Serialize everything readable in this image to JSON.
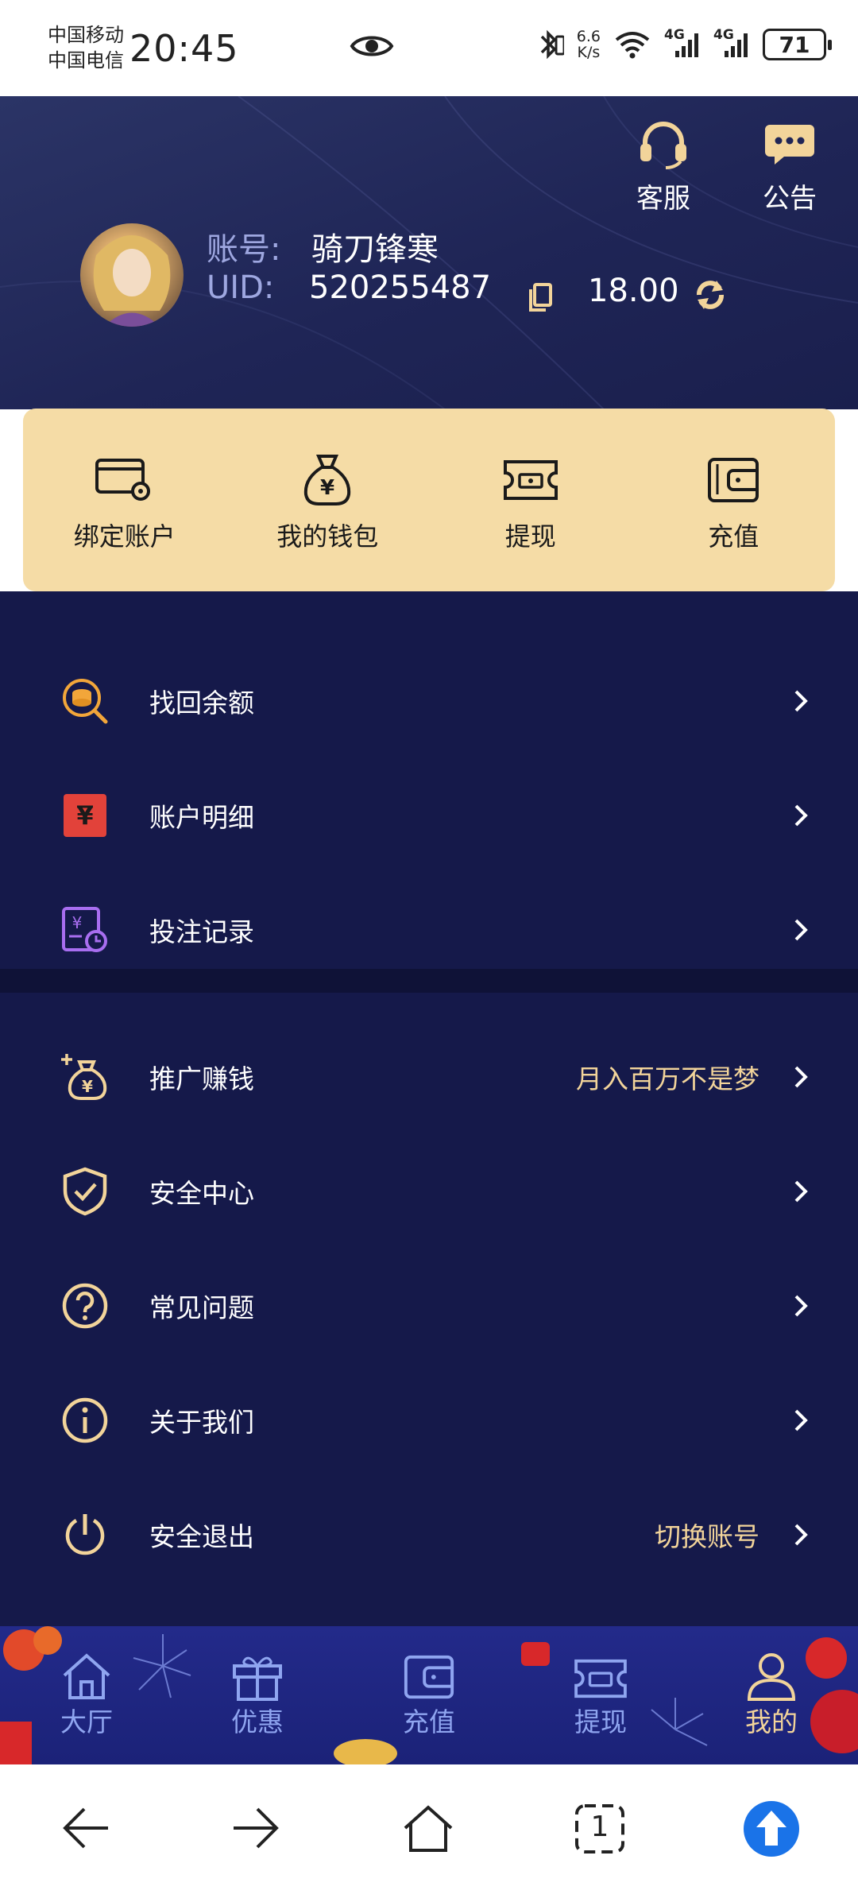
{
  "status_bar": {
    "carrier1": "中国移动",
    "carrier2": "中国电信",
    "time": "20:45",
    "net_speed_value": "6.6",
    "net_speed_unit": "K/s",
    "network1": "4G",
    "network2": "4G",
    "battery": "71"
  },
  "header": {
    "service_label": "客服",
    "notice_label": "公告",
    "account_label": "账号:",
    "account_value": "骑刀锋寒",
    "uid_label": "UID:",
    "uid_value": "520255487",
    "balance": "18.00"
  },
  "quick_actions": [
    {
      "label": "绑定账户",
      "icon": "card-settings-icon"
    },
    {
      "label": "我的钱包",
      "icon": "money-bag-icon"
    },
    {
      "label": "提现",
      "icon": "ticket-icon"
    },
    {
      "label": "充值",
      "icon": "wallet-icon"
    }
  ],
  "menu": [
    {
      "label": "找回余额",
      "icon": "coin-search-icon",
      "sub": ""
    },
    {
      "label": "账户明细",
      "icon": "account-detail-icon",
      "sub": ""
    },
    {
      "label": "投注记录",
      "icon": "bet-record-icon",
      "sub": ""
    },
    {
      "label": "推广赚钱",
      "icon": "promo-bag-icon",
      "sub": "月入百万不是梦"
    },
    {
      "label": "安全中心",
      "icon": "shield-check-icon",
      "sub": ""
    },
    {
      "label": "常见问题",
      "icon": "question-icon",
      "sub": ""
    },
    {
      "label": "关于我们",
      "icon": "info-icon",
      "sub": ""
    },
    {
      "label": "安全退出",
      "icon": "power-icon",
      "sub": "切换账号"
    }
  ],
  "tabbar": [
    {
      "label": "大厅",
      "icon": "home-icon"
    },
    {
      "label": "优惠",
      "icon": "gift-icon"
    },
    {
      "label": "充值",
      "icon": "wallet-icon"
    },
    {
      "label": "提现",
      "icon": "ticket-icon"
    },
    {
      "label": "我的",
      "icon": "user-icon",
      "active": true
    }
  ],
  "system_nav": {
    "tab_count": "1"
  },
  "colors": {
    "header_bg": "#1f2556",
    "card_bg": "#f5dca6",
    "body_bg": "#15194a",
    "accent_gold": "#f2d49a",
    "tabbar_bg": "#1f2680",
    "active_blue": "#1a73e8"
  }
}
